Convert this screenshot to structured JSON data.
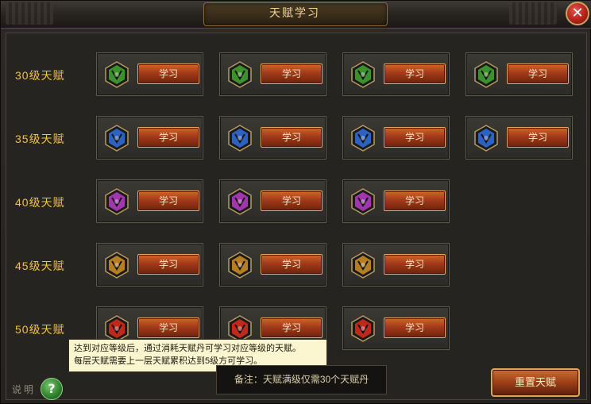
{
  "window": {
    "title": "天赋学习"
  },
  "rows": [
    {
      "label": "30级天赋",
      "slots": [
        {
          "button": "学习",
          "icon": "green-talent-rune-icon",
          "color": "#3fa02f"
        },
        {
          "button": "学习",
          "icon": "green-talent-rune-icon",
          "color": "#3fa02f"
        },
        {
          "button": "学习",
          "icon": "green-talent-rune-icon",
          "color": "#3fa02f"
        },
        {
          "button": "学习",
          "icon": "green-talent-rune-icon",
          "color": "#3fa02f"
        }
      ]
    },
    {
      "label": "35级天赋",
      "slots": [
        {
          "button": "学习",
          "icon": "blue-talent-rune-icon",
          "color": "#2f6ad4"
        },
        {
          "button": "学习",
          "icon": "blue-talent-rune-icon",
          "color": "#2f6ad4"
        },
        {
          "button": "学习",
          "icon": "blue-talent-rune-icon",
          "color": "#2f6ad4"
        },
        {
          "button": "学习",
          "icon": "blue-talent-rune-icon",
          "color": "#2f6ad4"
        }
      ]
    },
    {
      "label": "40级天赋",
      "slots": [
        {
          "button": "学习",
          "icon": "purple-talent-rune-icon",
          "color": "#b23ac0"
        },
        {
          "button": "学习",
          "icon": "purple-talent-rune-icon",
          "color": "#b23ac0"
        },
        {
          "button": "学习",
          "icon": "purple-talent-rune-icon",
          "color": "#b23ac0"
        }
      ]
    },
    {
      "label": "45级天赋",
      "slots": [
        {
          "button": "学习",
          "icon": "gold-talent-rune-icon",
          "color": "#c98a22"
        },
        {
          "button": "学习",
          "icon": "gold-talent-rune-icon",
          "color": "#c98a22"
        },
        {
          "button": "学习",
          "icon": "gold-talent-rune-icon",
          "color": "#c98a22"
        }
      ]
    },
    {
      "label": "50级天赋",
      "slots": [
        {
          "button": "学习",
          "icon": "red-talent-rune-icon",
          "color": "#d22a1c"
        },
        {
          "button": "学习",
          "icon": "red-talent-rune-icon",
          "color": "#d22a1c"
        },
        {
          "button": "学习",
          "icon": "red-talent-rune-icon",
          "color": "#d22a1c"
        }
      ]
    }
  ],
  "tooltip": {
    "line1": "达到对应等级后，通过消耗天赋丹可学习对应等级的天赋。",
    "line2": "每层天赋需要上一层天赋累积达到5级方可学习。"
  },
  "note": "备注：天赋满级仅需30个天赋丹",
  "footer": {
    "explain": "说明",
    "help_icon": "question-mark-icon",
    "reset_button": "重置天赋"
  },
  "close_icon": "close-icon"
}
